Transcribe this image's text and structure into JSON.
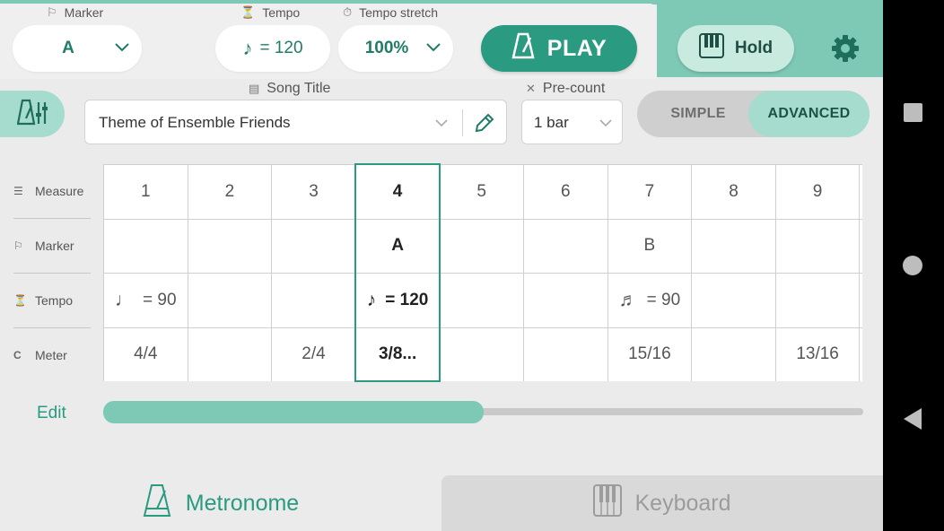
{
  "header": {
    "marker": {
      "label": "Marker",
      "value": "A"
    },
    "tempo": {
      "label": "Tempo",
      "note_symbol": "♪",
      "value": "= 120"
    },
    "tempo_stretch": {
      "label": "Tempo stretch",
      "value": "100%"
    },
    "play_label": "PLAY",
    "hold_label": "Hold"
  },
  "song": {
    "label": "Song Title",
    "value": "Theme of Ensemble Friends"
  },
  "precount": {
    "label": "Pre-count",
    "value": "1 bar"
  },
  "mode": {
    "simple_label": "SIMPLE",
    "advanced_label": "ADVANCED",
    "selected": "ADVANCED"
  },
  "grid": {
    "row_labels": {
      "measure": "Measure",
      "marker": "Marker",
      "tempo": "Tempo",
      "meter": "Meter"
    },
    "selected_measure": 4,
    "columns": [
      {
        "measure": "1",
        "marker": "",
        "tempo": "= 90",
        "tempo_note": "♩",
        "meter": "4/4"
      },
      {
        "measure": "2",
        "marker": "",
        "tempo": "",
        "tempo_note": "",
        "meter": ""
      },
      {
        "measure": "3",
        "marker": "",
        "tempo": "",
        "tempo_note": "",
        "meter": "2/4"
      },
      {
        "measure": "4",
        "marker": "A",
        "tempo": "= 120",
        "tempo_note": "♪",
        "meter": "3/8..."
      },
      {
        "measure": "5",
        "marker": "",
        "tempo": "",
        "tempo_note": "",
        "meter": ""
      },
      {
        "measure": "6",
        "marker": "",
        "tempo": "",
        "tempo_note": "",
        "meter": ""
      },
      {
        "measure": "7",
        "marker": "B",
        "tempo": "= 90",
        "tempo_note": "♬",
        "meter": "15/16"
      },
      {
        "measure": "8",
        "marker": "",
        "tempo": "",
        "tempo_note": "",
        "meter": ""
      },
      {
        "measure": "9",
        "marker": "",
        "tempo": "",
        "tempo_note": "",
        "meter": "13/16"
      },
      {
        "measure": "",
        "marker": "",
        "tempo": "",
        "tempo_note": "",
        "meter": ""
      }
    ],
    "scroll_fraction": 0.5
  },
  "edit_label": "Edit",
  "tabs": {
    "metronome_label": "Metronome",
    "keyboard_label": "Keyboard",
    "active": "Metronome"
  },
  "colors": {
    "accent": "#2a9a80",
    "accent_light": "#7ec8b6",
    "accent_pale": "#a6dccd"
  }
}
